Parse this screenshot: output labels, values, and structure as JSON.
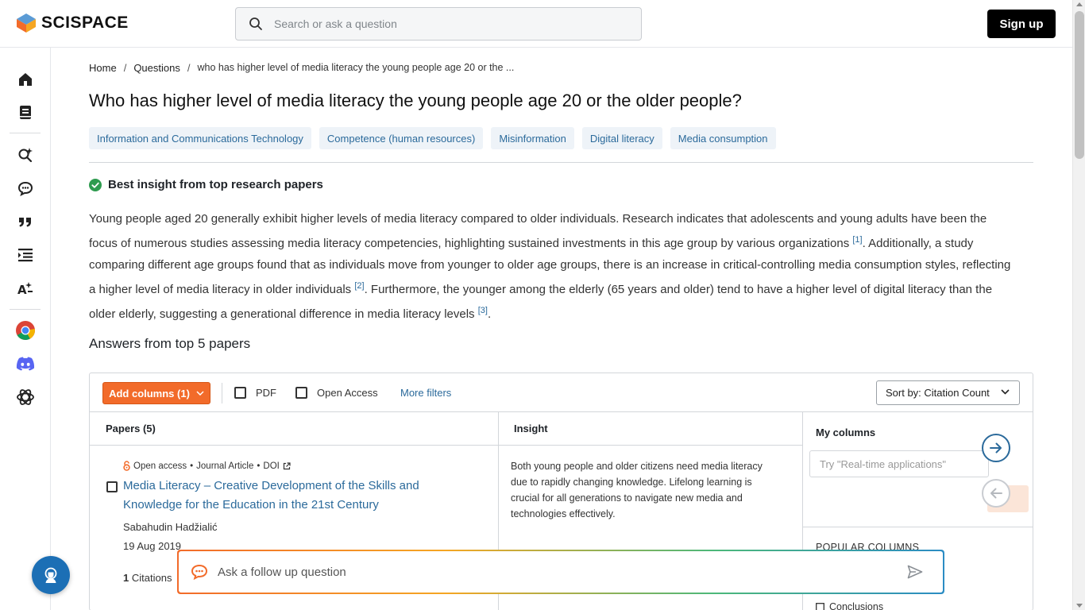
{
  "header": {
    "brand": "SCISPACE",
    "search_placeholder": "Search or ask a question",
    "signup_label": "Sign up"
  },
  "sidebar": {
    "items": [
      "home-icon",
      "library-icon",
      "search-ai-icon",
      "chat-icon",
      "quote-icon",
      "outline-icon",
      "ai-writer-icon",
      "chrome-icon",
      "discord-icon",
      "openai-icon"
    ]
  },
  "breadcrumb": {
    "home": "Home",
    "questions": "Questions",
    "current": "who has higher level of media literacy the young people age 20 or the ..."
  },
  "page_title": "Who has higher level of media literacy the young people age 20 or the older people?",
  "tags": [
    "Information and Communications Technology",
    "Competence (human resources)",
    "Misinformation",
    "Digital literacy",
    "Media consumption"
  ],
  "insight": {
    "heading": "Best insight from top research papers",
    "p1": "Young people aged 20 generally exhibit higher levels of media literacy compared to older individuals. Research indicates that adolescents and young adults have been the focus of numerous studies assessing media literacy competencies, highlighting sustained investments in this age group by various organizations ",
    "ref1": "[1]",
    "p2": ". Additionally, a study comparing different age groups found that as individuals move from younger to older age groups, there is an increase in critical-controlling media consumption styles, reflecting a higher level of media literacy in older individuals ",
    "ref2": "[2]",
    "p3": ". Furthermore, the younger among the elderly (65 years and older) tend to have a higher level of digital literacy than the older elderly, suggesting a generational difference in media literacy levels ",
    "ref3": "[3]",
    "p4": "."
  },
  "answers_title": "Answers from top 5 papers",
  "toolbar": {
    "add_columns": "Add columns (1)",
    "pdf": "PDF",
    "open_access": "Open Access",
    "more_filters": "More filters",
    "sort": "Sort by: Citation Count"
  },
  "table": {
    "col_papers": "Papers (5)",
    "col_insight": "Insight",
    "rows": [
      {
        "meta_oa": "Open access",
        "meta_type": "Journal Article",
        "meta_doi": "DOI",
        "title": "Media Literacy – Creative Development of the Skills and Knowledge for the Education in the 21st Century",
        "author": "Sabahudin Hadžialić",
        "date": "19 Aug 2019",
        "citations_count": "1",
        "citations_label": "Citations",
        "insight": "Both young people and older citizens need media literacy due to rapidly changing knowledge. Lifelong learning is crucial for all generations to navigate new media and technologies effectively."
      }
    ]
  },
  "my_columns": {
    "title": "My columns",
    "try_placeholder": "Try  \"Real-time applications\"",
    "popular_title": "POPULAR COLUMNS",
    "popular_items": [
      "Conclusions"
    ]
  },
  "followup": {
    "placeholder": "Ask a follow up question"
  },
  "colors": {
    "accent_orange": "#f26b2a",
    "link_blue": "#2b6a9b",
    "check_green": "#2e9b4f"
  }
}
